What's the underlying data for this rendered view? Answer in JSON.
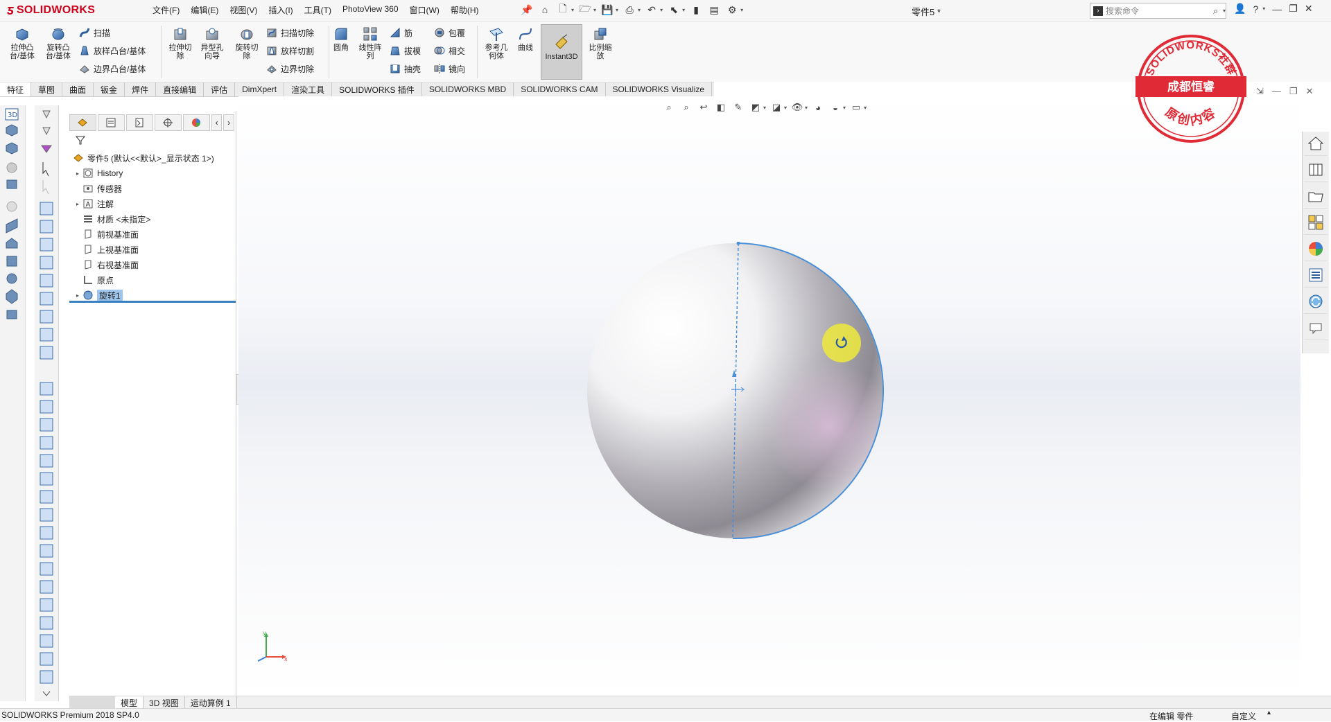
{
  "app": {
    "logo_text": "SOLIDWORKS",
    "doc_title": "零件5 *",
    "colors": {
      "brand_red": "#d0021b",
      "selection_blue": "#4a90d9",
      "stamp_red": "#e02a36"
    }
  },
  "menu": [
    "文件(F)",
    "编辑(E)",
    "视图(V)",
    "插入(I)",
    "工具(T)",
    "PhotoView 360",
    "窗口(W)",
    "帮助(H)"
  ],
  "search": {
    "placeholder": "搜索命令"
  },
  "commands": {
    "extrude_boss": "拉伸凸\n台/基体",
    "revolve_boss": "旋转凸\n台/基体",
    "sweep": "扫描",
    "loft_boss": "放样凸台/基体",
    "boundary_boss": "边界凸台/基体",
    "extrude_cut": "拉伸切\n除",
    "hole_wizard": "异型孔\n向导",
    "revolve_cut": "旋转切\n除",
    "sweep_cut": "扫描切除",
    "loft_cut": "放样切割",
    "boundary_cut": "边界切除",
    "fillet": "圆角",
    "linear_pattern": "线性阵\n列",
    "rib": "筋",
    "draft": "拔模",
    "shell": "抽壳",
    "wrap": "包覆",
    "intersect": "相交",
    "mirror": "镜向",
    "ref_geometry": "参考几\n何体",
    "curves": "曲线",
    "instant3d": "Instant3D",
    "scale": "比例缩\n放"
  },
  "tabs": [
    "特征",
    "草图",
    "曲面",
    "钣金",
    "焊件",
    "直接编辑",
    "评估",
    "DimXpert",
    "渲染工具",
    "SOLIDWORKS 插件",
    "SOLIDWORKS MBD",
    "SOLIDWORKS CAM",
    "SOLIDWORKS Visualize"
  ],
  "tree": {
    "root": "零件5 (默认<<默认>_显示状态 1>)",
    "items": [
      {
        "label": "History",
        "expandable": true,
        "icon": "history-icon"
      },
      {
        "label": "传感器",
        "expandable": false,
        "icon": "sensor-icon"
      },
      {
        "label": "注解",
        "expandable": true,
        "icon": "annotation-icon"
      },
      {
        "label": "材质 <未指定>",
        "expandable": false,
        "icon": "material-icon"
      },
      {
        "label": "前视基准面",
        "expandable": false,
        "icon": "plane-icon"
      },
      {
        "label": "上视基准面",
        "expandable": false,
        "icon": "plane-icon"
      },
      {
        "label": "右视基准面",
        "expandable": false,
        "icon": "plane-icon"
      },
      {
        "label": "原点",
        "expandable": false,
        "icon": "origin-icon"
      },
      {
        "label": "旋转1",
        "expandable": true,
        "icon": "revolve-icon",
        "selected": true
      }
    ]
  },
  "stamp": {
    "top_text": "SOLIDWORKS社群",
    "banner": "成都恒睿",
    "bottom_text": "原创内容"
  },
  "triad": {
    "x": "x",
    "y": "y"
  },
  "bottom_tabs": [
    "模型",
    "3D 视图",
    "运动算例 1"
  ],
  "status": {
    "product": "SOLIDWORKS Premium 2018 SP4.0",
    "mode": "在编辑 零件",
    "units": "自定义",
    "arrow": "▴"
  }
}
